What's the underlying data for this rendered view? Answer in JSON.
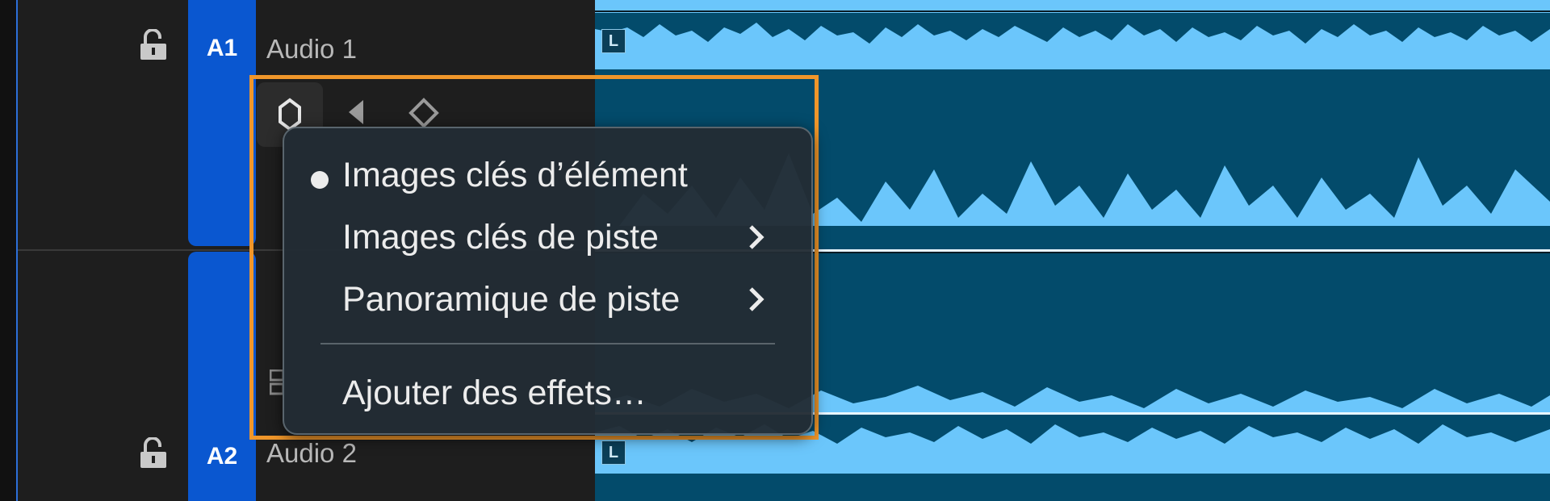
{
  "tracks": [
    {
      "id": "A1",
      "name": "Audio 1",
      "channel": "L"
    },
    {
      "id": "A2",
      "name": "Audio 2",
      "channel": "L"
    }
  ],
  "context_menu": {
    "items": [
      {
        "label": "Images clés d’élément",
        "selected": true,
        "submenu": false
      },
      {
        "label": "Images clés de piste",
        "selected": false,
        "submenu": true
      },
      {
        "label": "Panoramique de piste",
        "selected": false,
        "submenu": true
      },
      {
        "label": "Ajouter des effets…",
        "selected": false,
        "submenu": false
      }
    ]
  },
  "colors": {
    "track_badge": "#0a57d0",
    "highlight": "#f0962a",
    "waveform_light": "#6bc6fb",
    "waveform_dark": "#034b6b"
  },
  "icons": [
    "lock-open-icon",
    "keyframe-diamond-icon",
    "previous-keyframe-icon",
    "add-keyframe-icon",
    "chevron-right-icon"
  ]
}
